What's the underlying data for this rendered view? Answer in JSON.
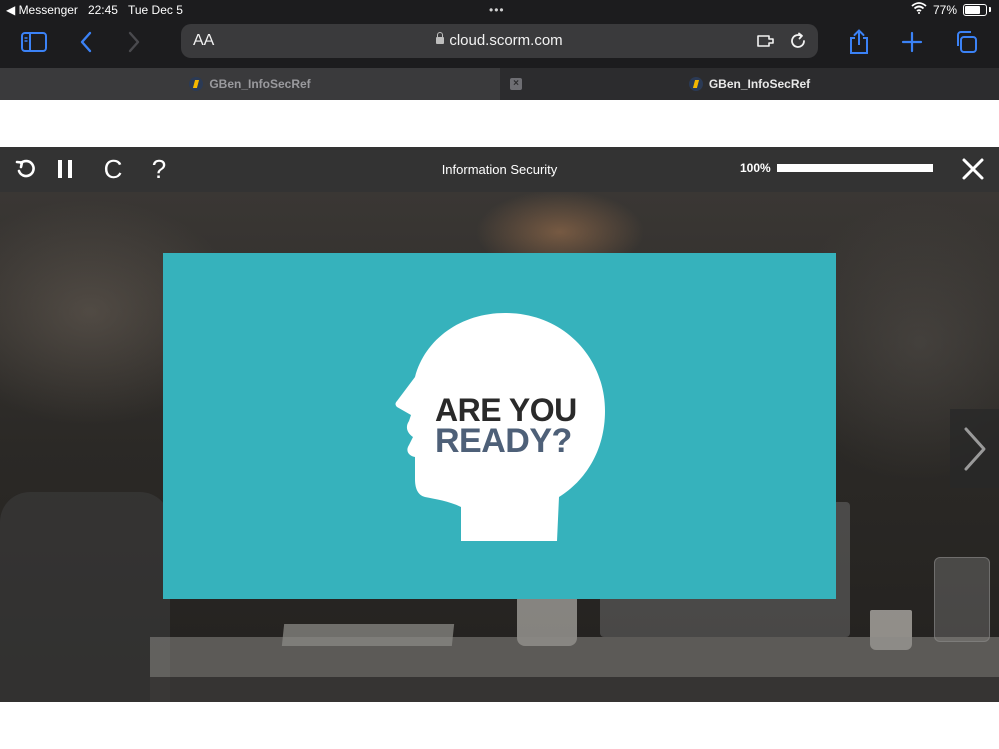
{
  "status_bar": {
    "back_app": "◀ Messenger",
    "time": "22:45",
    "date": "Tue Dec 5",
    "dots": "•••",
    "battery_percent": "77%",
    "battery_level": 0.77
  },
  "toolbar": {
    "text_size_label": "AA",
    "url": "cloud.scorm.com"
  },
  "tabs": [
    {
      "title": "GBen_InfoSecRef",
      "active": false
    },
    {
      "title": "GBen_InfoSecRef",
      "active": true
    }
  ],
  "tab_close_glyph": "×",
  "player": {
    "help_label": "?",
    "captions_label": "C",
    "title": "Information Security",
    "progress_label": "100%",
    "progress_value": 1.0
  },
  "slide": {
    "line1": "ARE YOU",
    "line2": "READY?",
    "background": "#36b2bc",
    "line1_color": "#2a2a2a",
    "line2_color": "#4e6078"
  },
  "colors": {
    "accent": "#3b82f6",
    "player_bar": "#333333"
  }
}
